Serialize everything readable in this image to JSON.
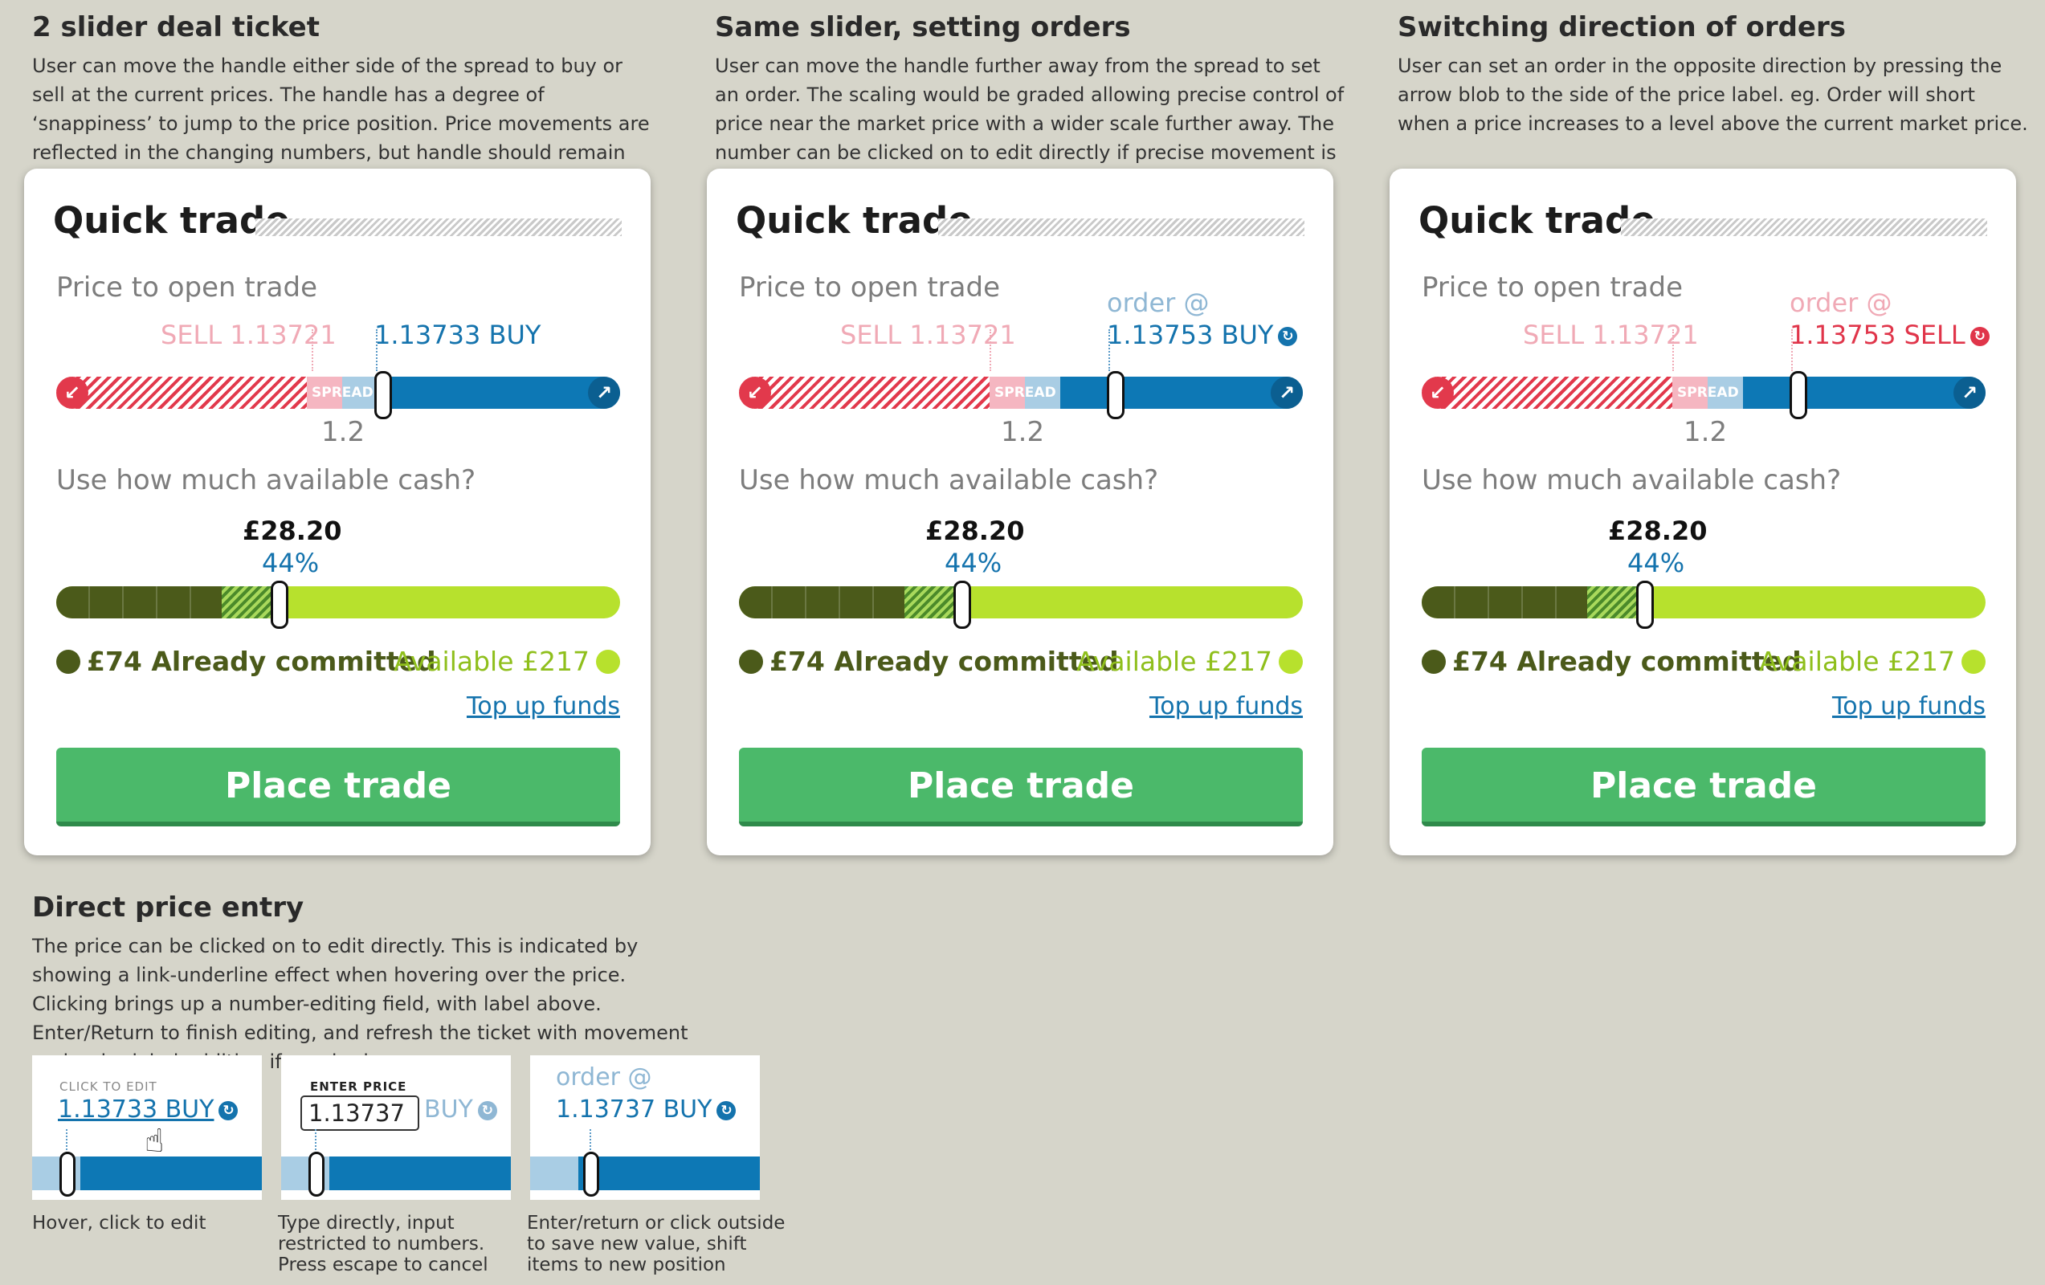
{
  "sections": {
    "s1": {
      "title": "2 slider deal ticket",
      "desc": "User can move the handle either side of the spread to buy or sell at the current prices. The handle has a degree of ‘snappiness’ to jump to the price position. Price movements are reflected in the changing numbers, but handle should remain static"
    },
    "s2": {
      "title": "Same slider, setting orders",
      "desc": "User can move the handle further away from the spread to set an order. The scaling would be graded allowing precise control of price near the market price with a wider scale further away. The number can be clicked on to edit directly if precise movement is required."
    },
    "s3": {
      "title": "Switching direction of orders",
      "desc": "User can set an order in the opposite direction by pressing the arrow blob to the side of the price label. eg. Order will short when a price increases to a level above the current market price."
    },
    "s4": {
      "title": "Direct price entry",
      "desc": "The price can be clicked on to edit directly. This is indicated by showing a link-underline effect when hovering over the price. Clicking brings up a number-editing field, with label above. Enter/Return to finish editing, and refresh the ticket with movement and order label addition if required."
    }
  },
  "ticket": {
    "title": "Quick trade",
    "price_label": "Price to open trade",
    "sell_price": "SELL 1.13721",
    "spread_label": "SPREAD",
    "spread_value": "1.2",
    "cash_label": "Use how much available cash?",
    "cash_amount": "£28.20",
    "cash_percent": "44%",
    "committed": "£74 Already committed",
    "available": "Available £217",
    "topup": "Top up funds",
    "place": "Place trade",
    "order_at": "order @"
  },
  "tickets": [
    {
      "buy_price": "1.13733 BUY"
    },
    {
      "buy_price": "1.13753 BUY"
    },
    {
      "buy_price": "1.13753 SELL"
    }
  ],
  "mini": {
    "click_to_edit": "CLICK TO EDIT",
    "enter_price": "ENTER PRICE",
    "price1": "1.13733 BUY",
    "input_value": "1.13737",
    "buy_suffix": "BUY",
    "order_at": "order @",
    "price3": "1.13737 BUY",
    "cap1": "Hover, click to edit",
    "cap2": "Type directly, input restricted to numbers. Press escape to cancel",
    "cap3": "Enter/return or click outside to save new value, shift items to new position"
  },
  "icons": {
    "sell_arrow": "arrow-down-left-icon",
    "buy_arrow": "arrow-up-right-icon",
    "switch_direction": "rotate-icon",
    "cursor": "hand-cursor-icon"
  },
  "colors": {
    "background": "#d6d5ca",
    "sell": "#e2394c",
    "buy": "#0d78b5",
    "committed": "#4b5a1a",
    "available": "#b7e12d",
    "place_button": "#4bb96a"
  },
  "cash_fill_percent": 44
}
